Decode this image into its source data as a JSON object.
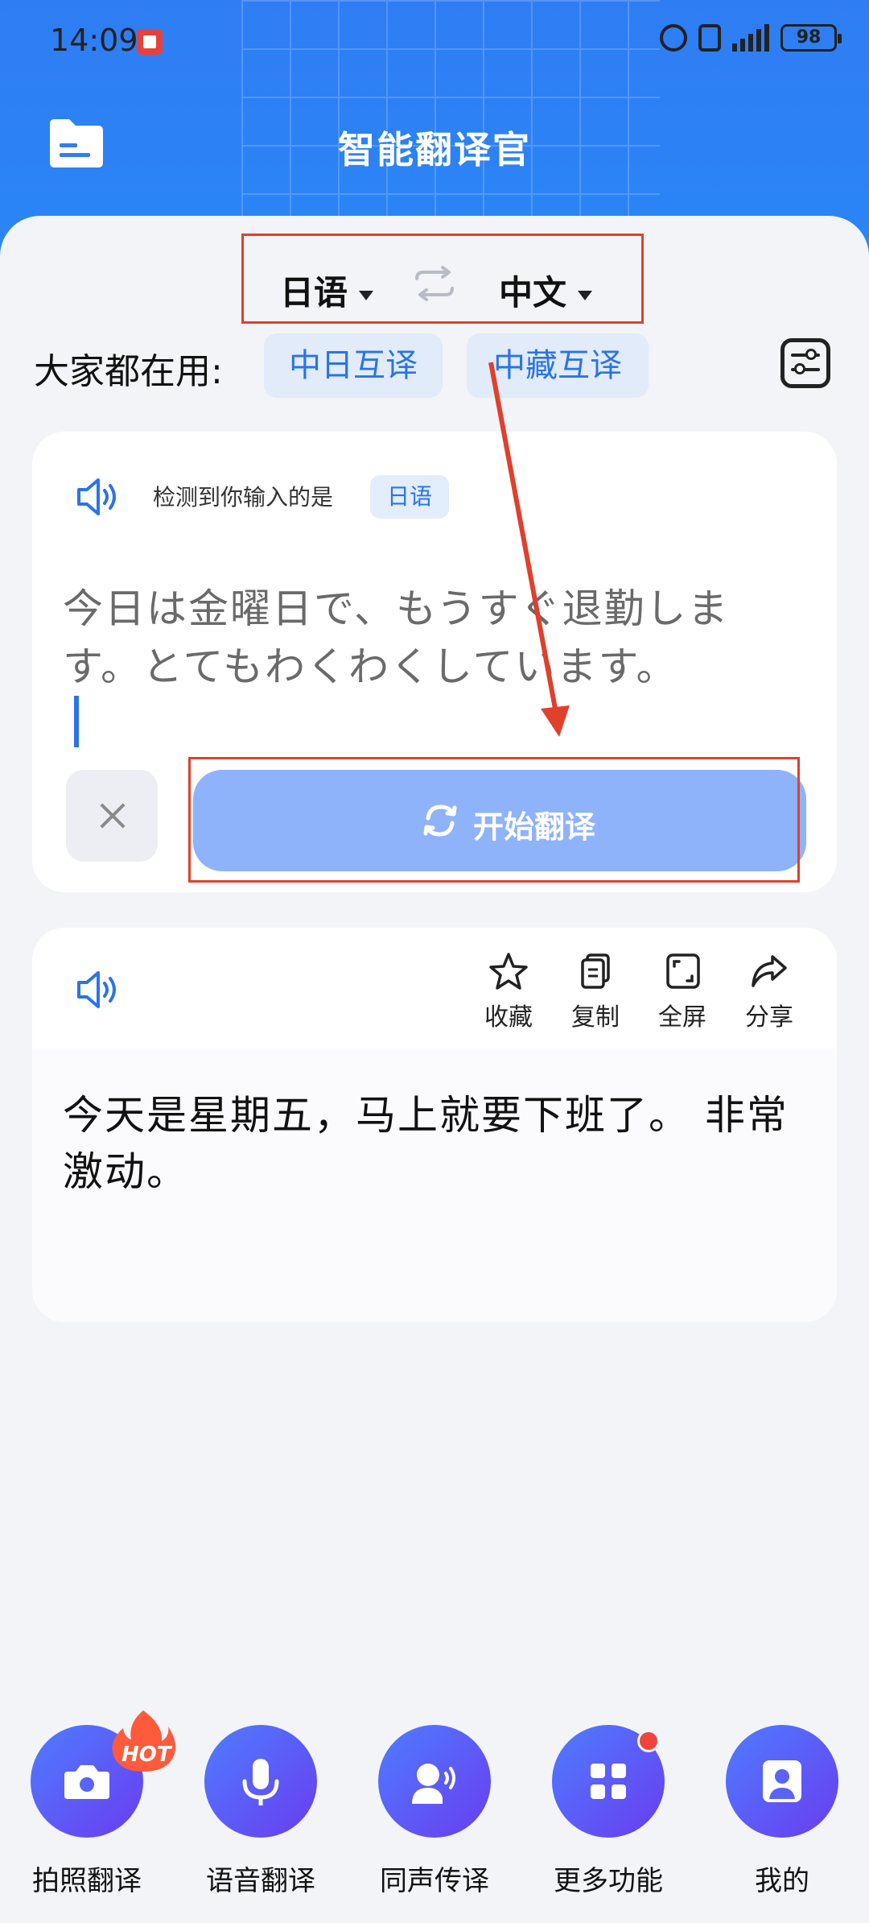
{
  "status_bar": {
    "time": "14:09",
    "battery": "98",
    "network": "4G"
  },
  "header": {
    "title": "智能翻译官"
  },
  "language_bar": {
    "source": "日语",
    "target": "中文"
  },
  "quick": {
    "label": "大家都在用:",
    "chips": [
      "中日互译",
      "中藏互译"
    ]
  },
  "input": {
    "detect_text": "检测到你输入的是",
    "detect_lang": "日语",
    "source_text": "今日は金曜日で、もうすぐ退勤します。とてもわくわくしています。",
    "translate_button": "开始翻译"
  },
  "output": {
    "actions": [
      "收藏",
      "复制",
      "全屏",
      "分享"
    ],
    "result_text": "今天是星期五，马上就要下班了。 非常激动。"
  },
  "bottom_nav": {
    "hot_badge": "HOT",
    "items": [
      "拍照翻译",
      "语音翻译",
      "同声传译",
      "更多功能",
      "我的"
    ]
  },
  "colors": {
    "accent": "#2a74e8",
    "annotation": "#e0402c",
    "button": "#8fb3fb"
  }
}
